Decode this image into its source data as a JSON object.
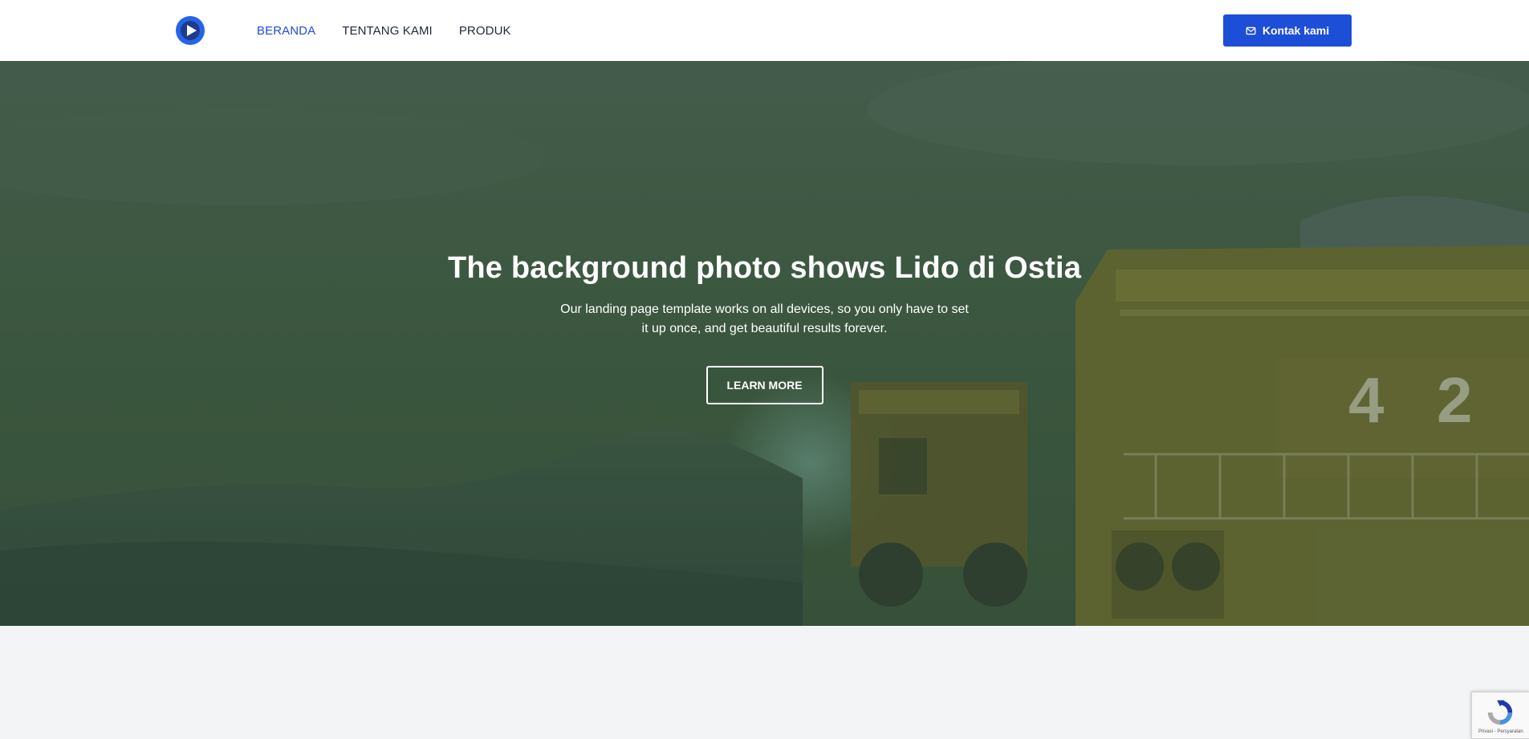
{
  "colors": {
    "accent": "#1d4ed8",
    "nav_text": "#1f2937",
    "page_bg": "#f3f4f6"
  },
  "header": {
    "logo_icon": "play-logo-icon",
    "nav": [
      {
        "label": "BERANDA",
        "active": true
      },
      {
        "label": "TENTANG KAMI",
        "active": false
      },
      {
        "label": "PRODUK",
        "active": false
      }
    ],
    "contact": {
      "icon": "mail-icon",
      "label": "Kontak kami"
    }
  },
  "hero": {
    "title": "The background photo shows Lido di Ostia",
    "subtitle": "Our landing page template works on all devices, so you only have to set it up once, and get beautiful results forever.",
    "button_label": "LEARN MORE",
    "background": "mining-trucks-photo"
  },
  "recaptcha": {
    "icon": "recaptcha-icon",
    "links": "Privasi - Persyaratan"
  }
}
